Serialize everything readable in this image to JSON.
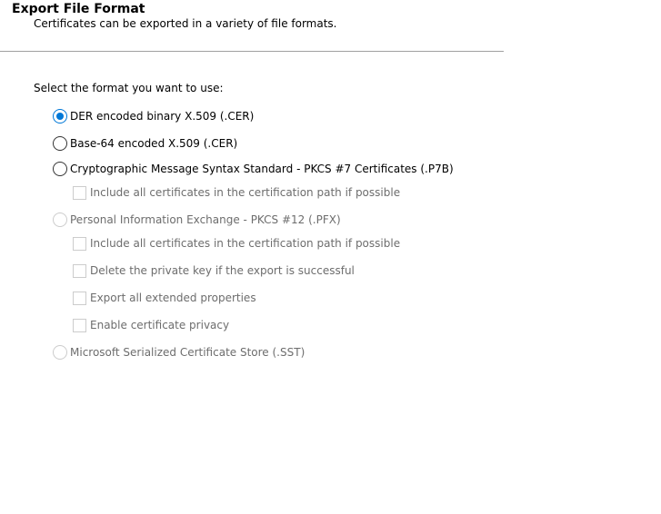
{
  "header": {
    "title": "Export File Format",
    "subtitle": "Certificates can be exported in a variety of file formats."
  },
  "prompt": "Select the format you want to use:",
  "options": {
    "der": {
      "label": "DER encoded binary X.509 (.CER)",
      "checked": true,
      "enabled": true
    },
    "base64": {
      "label": "Base-64 encoded X.509 (.CER)",
      "checked": false,
      "enabled": true
    },
    "pkcs7": {
      "label": "Cryptographic Message Syntax Standard - PKCS #7 Certificates (.P7B)",
      "checked": false,
      "enabled": true
    },
    "pkcs7_include_all": {
      "label": "Include all certificates in the certification path if possible",
      "checked": false,
      "enabled": false
    },
    "pfx": {
      "label": "Personal Information Exchange - PKCS #12 (.PFX)",
      "checked": false,
      "enabled": false
    },
    "pfx_include_all": {
      "label": "Include all certificates in the certification path if possible",
      "checked": false,
      "enabled": false
    },
    "pfx_delete_key": {
      "label": "Delete the private key if the export is successful",
      "checked": false,
      "enabled": false
    },
    "pfx_export_props": {
      "label": "Export all extended properties",
      "checked": false,
      "enabled": false
    },
    "pfx_privacy": {
      "label": "Enable certificate privacy",
      "checked": false,
      "enabled": false
    },
    "sst": {
      "label": "Microsoft Serialized Certificate Store (.SST)",
      "checked": false,
      "enabled": false
    }
  },
  "colors": {
    "accent": "#0078d7",
    "disabled_text": "#6d6d6d",
    "disabled_border": "#cccccc",
    "divider": "#a0a0a0"
  }
}
